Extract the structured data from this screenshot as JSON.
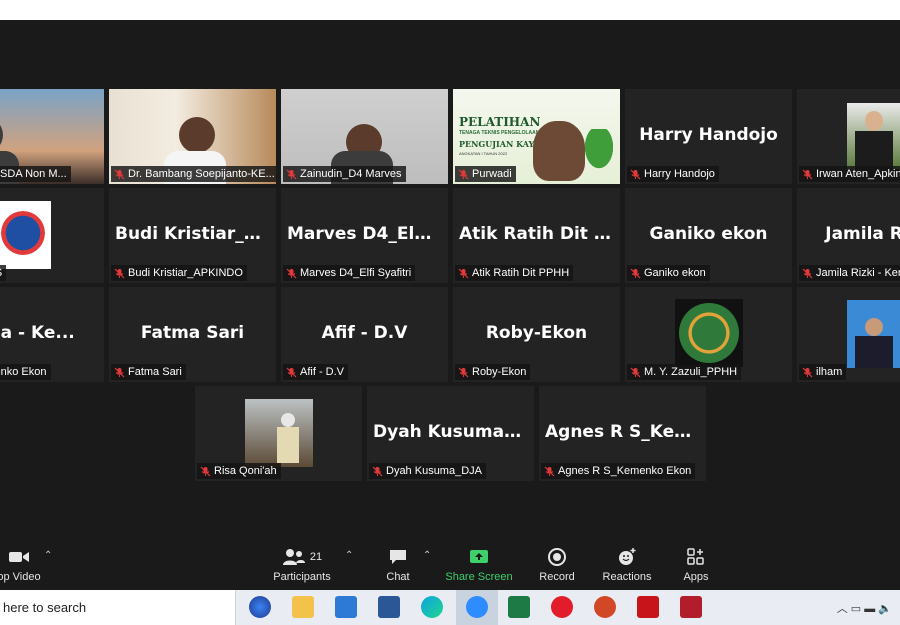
{
  "participants": [
    {
      "row": 0,
      "col": 0,
      "name": "Sebastian_Ling_Pen. SDA Non M...",
      "type": "video",
      "label_text": "ng_Pen. SDA Non M..."
    },
    {
      "row": 0,
      "col": 1,
      "name": "Dr. Bambang Soepijanto-KE...",
      "type": "video"
    },
    {
      "row": 0,
      "col": 2,
      "name": "Zainudin_D4 Marves",
      "type": "video"
    },
    {
      "row": 0,
      "col": 3,
      "name": "Purwadi",
      "type": "video",
      "speaking": true,
      "slide_title": "PELATIHAN",
      "slide_sub1": "TENAGA TEKNIS PENGELOLAAN",
      "slide_sub2": "PENGUJIAN KAYU B",
      "slide_sub3": "ANGKATAN I TAHUN 2022"
    },
    {
      "row": 0,
      "col": 4,
      "name": "Harry Handojo",
      "type": "name",
      "big": "Harry Handojo"
    },
    {
      "row": 0,
      "col": 5,
      "name": "Irwan Aten_Apkin",
      "type": "photo"
    },
    {
      "row": 1,
      "col": 0,
      "name": "MARVES",
      "type": "logo"
    },
    {
      "row": 1,
      "col": 1,
      "name": "Budi Kristiar_APKINDO",
      "type": "name",
      "big": "Budi  Kristiar_A..."
    },
    {
      "row": 1,
      "col": 2,
      "name": "Marves D4_Elfi Syafitri",
      "type": "name",
      "big": "Marves  D4_Elfi..."
    },
    {
      "row": 1,
      "col": 3,
      "name": "Atik Ratih Dit PPHH",
      "type": "name",
      "big": "Atik Ratih Dit P..."
    },
    {
      "row": 1,
      "col": 4,
      "name": "Ganiko ekon",
      "type": "name",
      "big": "Ganiko ekon"
    },
    {
      "row": 1,
      "col": 5,
      "name": "Jamila Rizki - Ken",
      "type": "name",
      "big": "Jamila Rizki"
    },
    {
      "row": 2,
      "col": 0,
      "name": "a - Kemenko Ekon",
      "type": "name",
      "big": "usna  -  Ke..."
    },
    {
      "row": 2,
      "col": 1,
      "name": "Fatma Sari",
      "type": "name",
      "big": "Fatma Sari"
    },
    {
      "row": 2,
      "col": 2,
      "name": "Afif - D.V",
      "type": "name",
      "big": "Afif  -  D.V"
    },
    {
      "row": 2,
      "col": 3,
      "name": "Roby-Ekon",
      "type": "name",
      "big": "Roby-Ekon"
    },
    {
      "row": 2,
      "col": 4,
      "name": "M. Y. Zazuli_PPHH",
      "type": "logo2"
    },
    {
      "row": 2,
      "col": 5,
      "name": "ilham",
      "type": "photo2"
    },
    {
      "row": 3,
      "col": 0,
      "name": "Risa Qoni'ah",
      "type": "photo3"
    },
    {
      "row": 3,
      "col": 1,
      "name": "Dyah Kusuma_DJA",
      "type": "name",
      "big": "Dyah  Kusuma_..."
    },
    {
      "row": 3,
      "col": 2,
      "name": "Agnes R S_Kemenko Ekon",
      "type": "name",
      "big": "Agnes  R  S_Kem..."
    }
  ],
  "toolbar": {
    "video_label": "op Video",
    "participants_label": "Participants",
    "participants_count": "21",
    "chat_label": "Chat",
    "share_label": "Share Screen",
    "record_label": "Record",
    "reactions_label": "Reactions",
    "apps_label": "Apps"
  },
  "taskbar": {
    "search_placeholder": "here to search"
  },
  "colors": {
    "stage_bg": "#1a1a1a",
    "tile_bg": "#232323",
    "speaking_outline": "#e8e26a",
    "share_green": "#3fd06b",
    "taskbar_bg": "#e9edf3"
  }
}
